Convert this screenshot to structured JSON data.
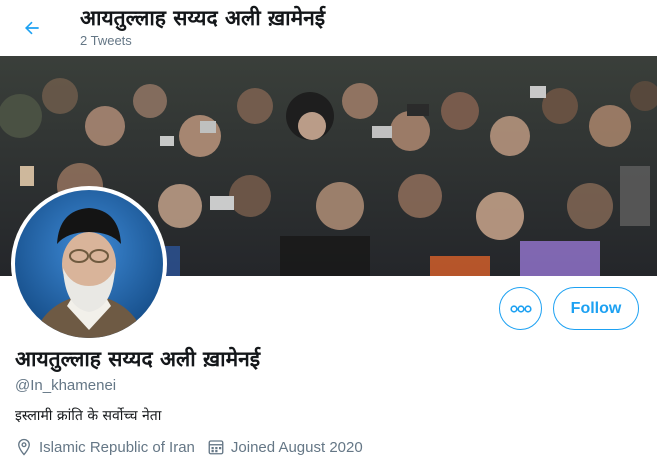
{
  "header": {
    "title": "आयतुल्लाह सय्यद अली ख़ामेनई",
    "subtitle": "2 Tweets"
  },
  "profile": {
    "name": "आयतुल्लाह सय्यद अली ख़ामेनई",
    "handle": "@In_khamenei",
    "bio": "इस्लामी क्रांति के सर्वोच्च नेता",
    "location": "Islamic Republic of Iran",
    "joined": "Joined August 2020"
  },
  "actions": {
    "follow_label": "Follow"
  },
  "icons": {
    "back": "arrow-left-icon",
    "more": "more-options-icon",
    "location": "location-pin-icon",
    "calendar": "calendar-icon"
  },
  "colors": {
    "accent": "#1da1f2",
    "text": "#14171a",
    "muted": "#657786"
  }
}
